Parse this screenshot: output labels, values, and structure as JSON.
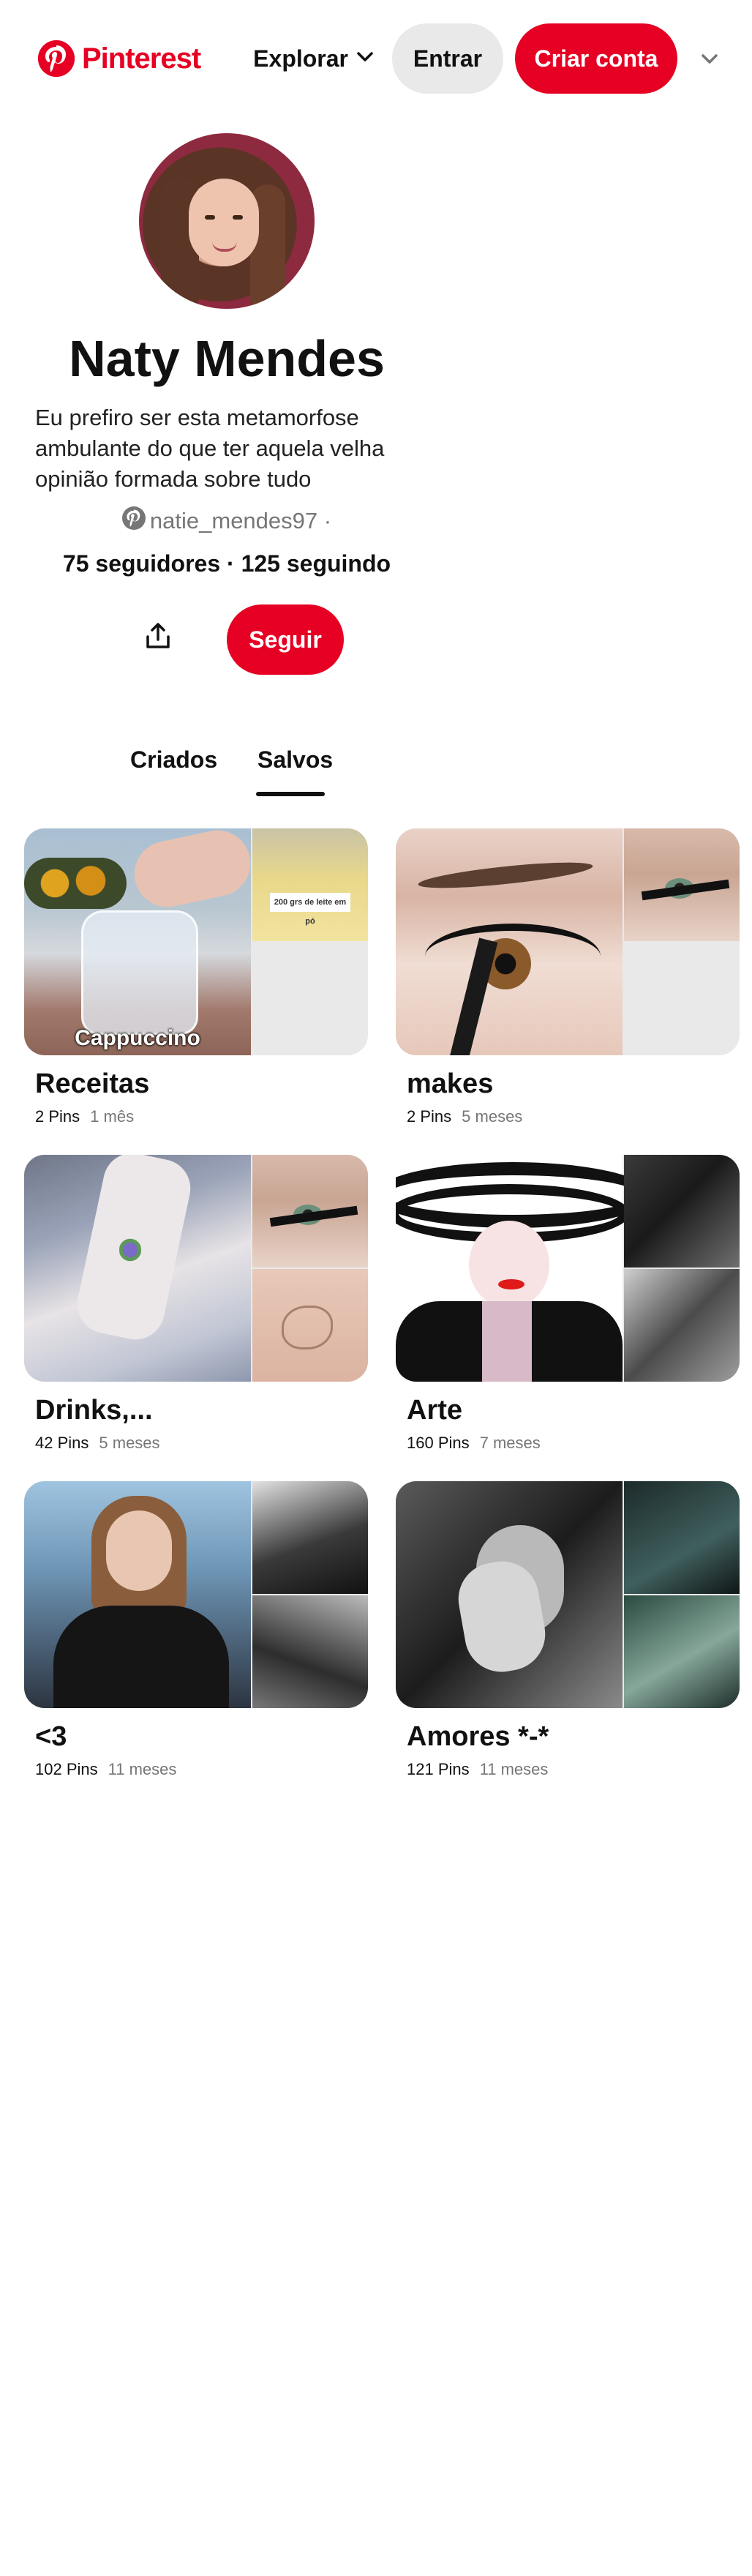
{
  "header": {
    "logo_text": "Pinterest",
    "explore_label": "Explorar",
    "login_label": "Entrar",
    "signup_label": "Criar conta",
    "brand_color": "#e60023"
  },
  "profile": {
    "name": "Naty Mendes",
    "bio": "Eu prefiro ser esta metamorfose ambulante do que ter aquela velha opinião formada sobre tudo",
    "handle": "natie_mendes97 ·",
    "stats": "75 seguidores · 125 seguindo",
    "follow_label": "Seguir"
  },
  "tabs": [
    {
      "label": "Criados",
      "active": false
    },
    {
      "label": "Salvos",
      "active": true
    }
  ],
  "boards": [
    {
      "title": "Receitas",
      "pins": "2 Pins",
      "age": "1 mês",
      "cover_caption": "Cappuccino",
      "cover_tag": "200 grs de leite em pó"
    },
    {
      "title": "makes",
      "pins": "2 Pins",
      "age": "5 meses"
    },
    {
      "title": "Drinks,...",
      "pins": "42 Pins",
      "age": "5 meses"
    },
    {
      "title": "Arte",
      "pins": "160 Pins",
      "age": "7 meses"
    },
    {
      "title": "<3",
      "pins": "102 Pins",
      "age": "11 meses"
    },
    {
      "title": "Amores *-*",
      "pins": "121 Pins",
      "age": "11 meses"
    }
  ]
}
